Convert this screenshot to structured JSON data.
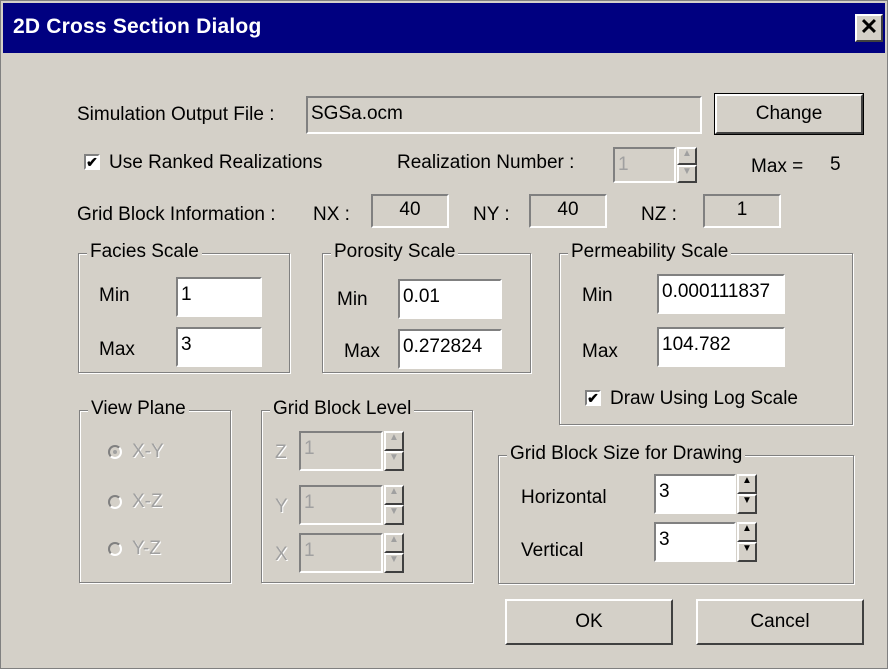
{
  "window": {
    "title": "2D Cross Section Dialog",
    "close_glyph": "✕"
  },
  "sim_output": {
    "label": "Simulation Output File :",
    "value": "SGSa.ocm",
    "change_label": "Change"
  },
  "ranked": {
    "label": "Use Ranked Realizations",
    "checked": true
  },
  "realization": {
    "label": "Realization Number :",
    "value": "1",
    "max_label": "Max =",
    "max_value": "5"
  },
  "grid_info": {
    "label": "Grid Block Information :",
    "nx_label": "NX :",
    "nx": "40",
    "ny_label": "NY :",
    "ny": "40",
    "nz_label": "NZ :",
    "nz": "1"
  },
  "facies": {
    "title": "Facies Scale",
    "min_label": "Min",
    "min": "1",
    "max_label": "Max",
    "max": "3"
  },
  "porosity": {
    "title": "Porosity Scale",
    "min_label": "Min",
    "min": "0.01",
    "max_label": "Max",
    "max": "0.272824"
  },
  "permeability": {
    "title": "Permeability Scale",
    "min_label": "Min",
    "min": "0.000111837",
    "max_label": "Max",
    "max": "104.782",
    "log_label": "Draw Using Log Scale",
    "log_checked": true
  },
  "view_plane": {
    "title": "View Plane",
    "options": [
      "X-Y",
      "X-Z",
      "Y-Z"
    ],
    "selected": "X-Y"
  },
  "grid_level": {
    "title": "Grid Block Level",
    "z_label": "Z",
    "z": "1",
    "y_label": "Y",
    "y": "1",
    "x_label": "X",
    "x": "1"
  },
  "draw_size": {
    "title": "Grid Block Size for Drawing",
    "h_label": "Horizontal",
    "h": "3",
    "v_label": "Vertical",
    "v": "3"
  },
  "buttons": {
    "ok": "OK",
    "cancel": "Cancel"
  },
  "icons": {
    "check": "✔",
    "spin_up": "▲",
    "spin_down": "▼"
  }
}
